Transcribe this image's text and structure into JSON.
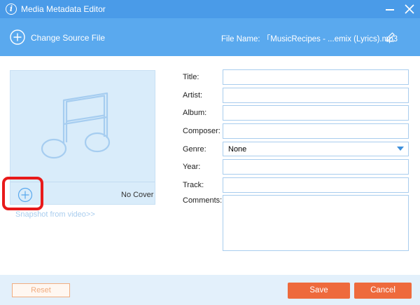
{
  "window": {
    "title": "Media Metadata Editor",
    "accent_color": "#4a9be8",
    "toolbar_color": "#5aa9ee"
  },
  "toolbar": {
    "change_source_label": "Change Source File",
    "file_name_label": "File Name:",
    "file_name_value": "「MusicRecipes -  ...emix (Lyrics).mp3",
    "icons": [
      "plus-circle-icon",
      "pencil-icon"
    ]
  },
  "cover": {
    "no_cover_label": "No Cover",
    "snapshot_link": "Snapshot from video>>",
    "icons": [
      "music-note-icon",
      "add-cover-icon"
    ]
  },
  "form": {
    "title_label": "Title:",
    "artist_label": "Artist:",
    "album_label": "Album:",
    "composer_label": "Composer:",
    "genre_label": "Genre:",
    "genre_value": "None",
    "year_label": "Year:",
    "track_label": "Track:",
    "comments_label": "Comments:",
    "title_value": "",
    "artist_value": "",
    "album_value": "",
    "composer_value": "",
    "year_value": "",
    "track_value": "",
    "comments_value": ""
  },
  "footer": {
    "reset_label": "Reset",
    "save_label": "Save",
    "cancel_label": "Cancel",
    "button_color": "#ee6a3c"
  }
}
